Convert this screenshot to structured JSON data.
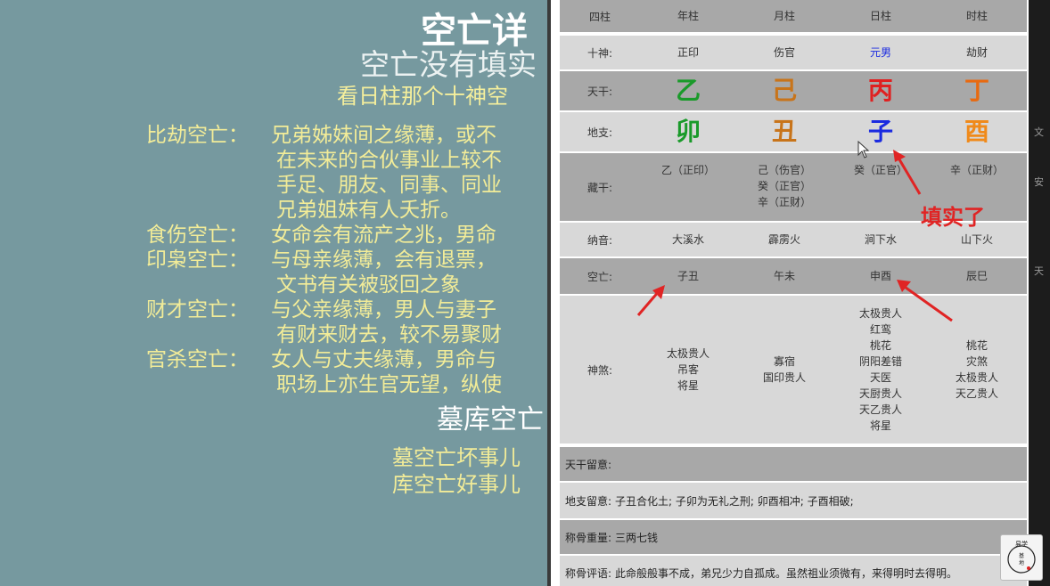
{
  "slide": {
    "title": "空亡详",
    "subtitle": "空亡没有填实",
    "hint": "看日柱那个十神空",
    "lines": [
      {
        "label": "比劫空亡：",
        "text": "兄弟姊妹间之缘薄，或不"
      },
      {
        "label": "",
        "text": "在未来的合伙事业上较不"
      },
      {
        "label": "",
        "text": "手足、朋友、同事、同业"
      },
      {
        "label": "",
        "text": "兄弟姐妹有人夭折。"
      },
      {
        "label": "食伤空亡：",
        "text": "女命会有流产之兆，男命"
      },
      {
        "label": "印枭空亡：",
        "text": "与母亲缘薄，会有退票，"
      },
      {
        "label": "",
        "text": "文书有关被驳回之象"
      },
      {
        "label": "财才空亡：",
        "text": "与父亲缘薄，男人与妻子"
      },
      {
        "label": "",
        "text": "有财来财去，较不易聚财"
      },
      {
        "label": "官杀空亡：",
        "text": "女人与丈夫缘薄，男命与"
      },
      {
        "label": "",
        "text": "职场上亦生官无望，纵使"
      }
    ],
    "section2": "墓库空亡",
    "mu1": "墓空亡坏事儿",
    "mu2": "库空亡好事儿"
  },
  "table": {
    "header": {
      "label": "四柱",
      "cols": [
        "年柱",
        "月柱",
        "日柱",
        "时柱"
      ]
    },
    "shishen": {
      "label": "十神:",
      "cols": [
        "正印",
        "伤官",
        "元男",
        "劫财"
      ]
    },
    "tiangan": {
      "label": "天干:",
      "cols": [
        "乙",
        "己",
        "丙",
        "丁"
      ]
    },
    "dizhi": {
      "label": "地支:",
      "cols": [
        "卯",
        "丑",
        "子",
        "酉"
      ]
    },
    "canggan": {
      "label": "藏干:",
      "cols": [
        [
          "乙（正印）"
        ],
        [
          "己（伤官）",
          "癸（正官）",
          "辛（正财）"
        ],
        [
          "癸（正官）"
        ],
        [
          "辛（正财）"
        ]
      ]
    },
    "nayin": {
      "label": "纳音:",
      "cols": [
        "大溪水",
        "霹雳火",
        "涧下水",
        "山下火"
      ]
    },
    "kongwang": {
      "label": "空亡:",
      "cols": [
        "子丑",
        "午未",
        "申酉",
        "辰巳"
      ]
    },
    "shensha": {
      "label": "神煞:",
      "cols": [
        [
          "太极贵人",
          "吊客",
          "将星"
        ],
        [
          "寡宿",
          "国印贵人"
        ],
        [
          "太极贵人",
          "红鸾",
          "桃花",
          "阴阳差错",
          "天医",
          "天厨贵人",
          "天乙贵人",
          "将星"
        ],
        [
          "桃花",
          "灾煞",
          "太极贵人",
          "天乙贵人"
        ]
      ]
    },
    "tiangan_liuyi": {
      "label": "天干留意:"
    },
    "dizhi_liuyi": {
      "label": "地支留意:",
      "text": "子丑合化土; 子卯为无礼之刑; 卯酉相冲; 子酉相破;"
    },
    "chenggu": {
      "label": "称骨重量:",
      "text": "三两七钱"
    },
    "pingyu": {
      "label": "称骨评语:",
      "text": "此命般般事不成，弟兄少力自孤成。虽然祖业须微有，来得明时去得明。"
    }
  },
  "annotation": "填实了",
  "colors": {
    "wood": "#1a9a2a",
    "earth": "#c8741a",
    "fire": "#e02020",
    "water": "#1a2ae0",
    "metal": "#f08a1a",
    "shishen_highlight": "#1a2ae0",
    "arrow": "#e02424",
    "slide_text_yellow": "#f2ec98"
  },
  "strip_labels": [
    "文",
    "安",
    "天"
  ],
  "seal_text": "易学基地"
}
